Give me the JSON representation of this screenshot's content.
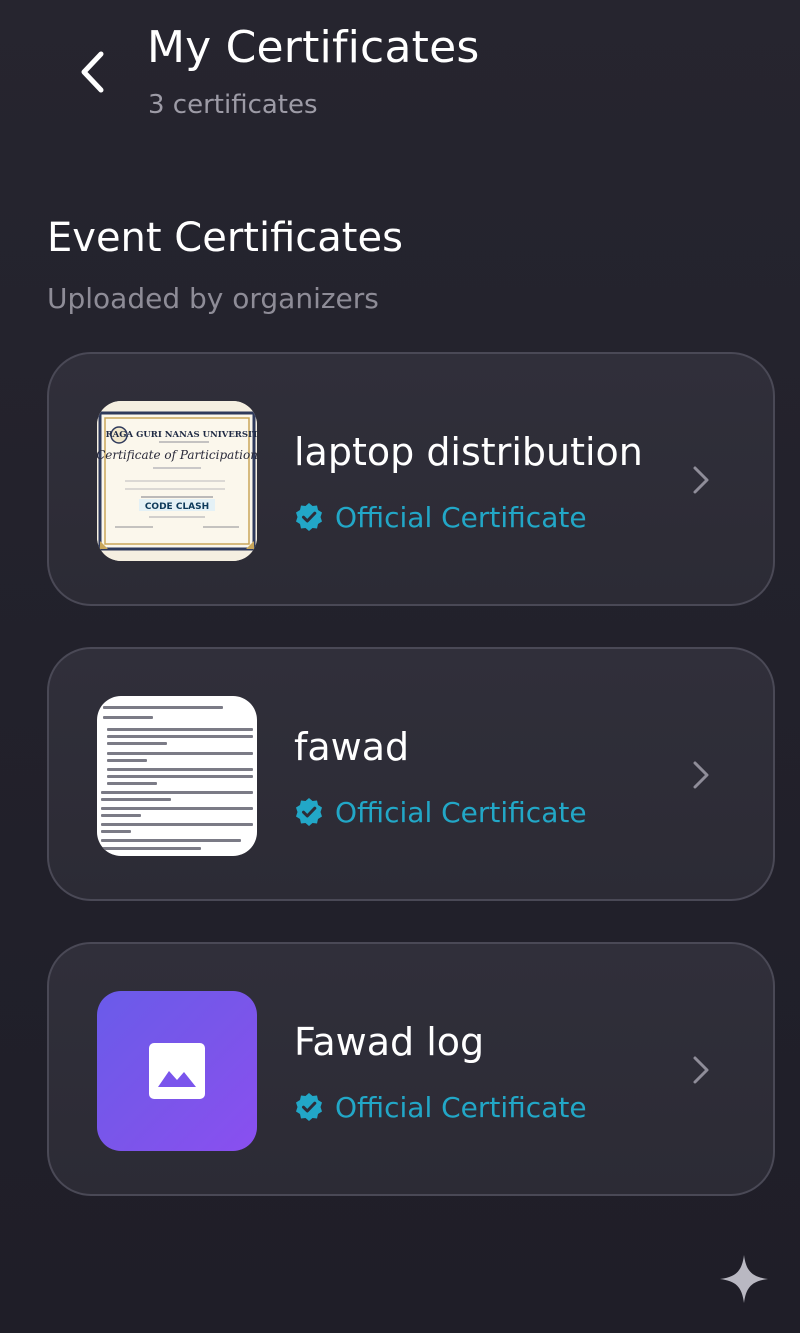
{
  "header": {
    "title": "My Certificates",
    "subtitle": "3 certificates"
  },
  "section": {
    "title": "Event Certificates",
    "subtitle": "Uploaded by organizers"
  },
  "certificates": [
    {
      "name": "laptop distribution",
      "badge": "Official Certificate",
      "thumb": {
        "university": "RAGA GURI NANAS UNIVERSITY",
        "heading": "Certificate of Participation",
        "event": "CODE CLASH"
      }
    },
    {
      "name": "fawad",
      "badge": "Official Certificate"
    },
    {
      "name": "Fawad log",
      "badge": "Official Certificate"
    }
  ],
  "colors": {
    "background": "#24232d",
    "card": "#2e2d38",
    "accent": "#22a7c7",
    "placeholder": "#7456ec"
  },
  "icons": {
    "back": "chevron-left-icon",
    "verified": "verified-badge-icon",
    "chevron": "chevron-right-icon",
    "image": "image-placeholder-icon",
    "sparkle": "sparkle-icon"
  }
}
